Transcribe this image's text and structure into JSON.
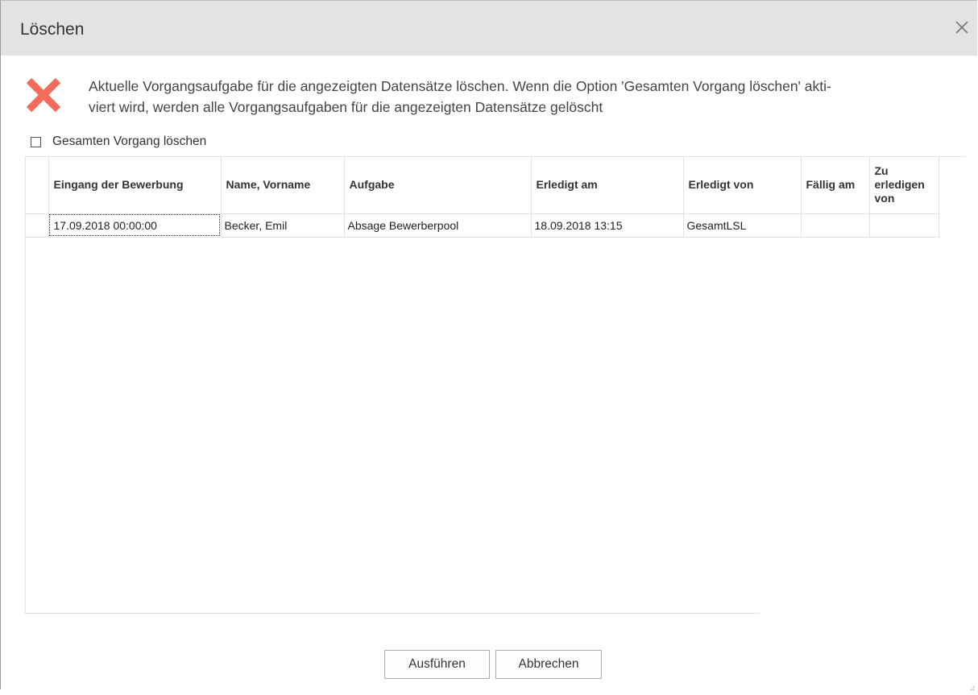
{
  "dialog": {
    "title": "Löschen",
    "close_icon": "close-icon",
    "message_icon": "delete-x-icon",
    "message_line1": "Aktuelle Vorgangsaufgabe für die angezeigten Datensätze löschen. Wenn die Option 'Gesamten Vorgang löschen' akti-",
    "message_line2": "viert wird, werden alle Vorgangsaufgaben für die angezeigten Datensätze gelöscht",
    "checkbox": {
      "label": "Gesamten Vorgang löschen",
      "checked": false
    },
    "accent_color": "#f26b5b"
  },
  "table": {
    "headers": {
      "eingang": "Eingang der Bewerbung",
      "name": "Name, Vorname",
      "aufgabe": "Aufgabe",
      "erledigt_am": "Erledigt am",
      "erledigt_von": "Erledigt von",
      "faellig_am": "Fällig am",
      "zu_erledigen_von": "Zu erledigen von"
    },
    "rows": [
      {
        "eingang": "17.09.2018 00:00:00",
        "name": "Becker, Emil",
        "aufgabe": "Absage Bewerberpool",
        "erledigt_am": "18.09.2018 13:15",
        "erledigt_von": "GesamtLSL",
        "faellig_am": "",
        "zu_erledigen_von": ""
      }
    ]
  },
  "buttons": {
    "run": "Ausführen",
    "cancel": "Abbrechen"
  }
}
